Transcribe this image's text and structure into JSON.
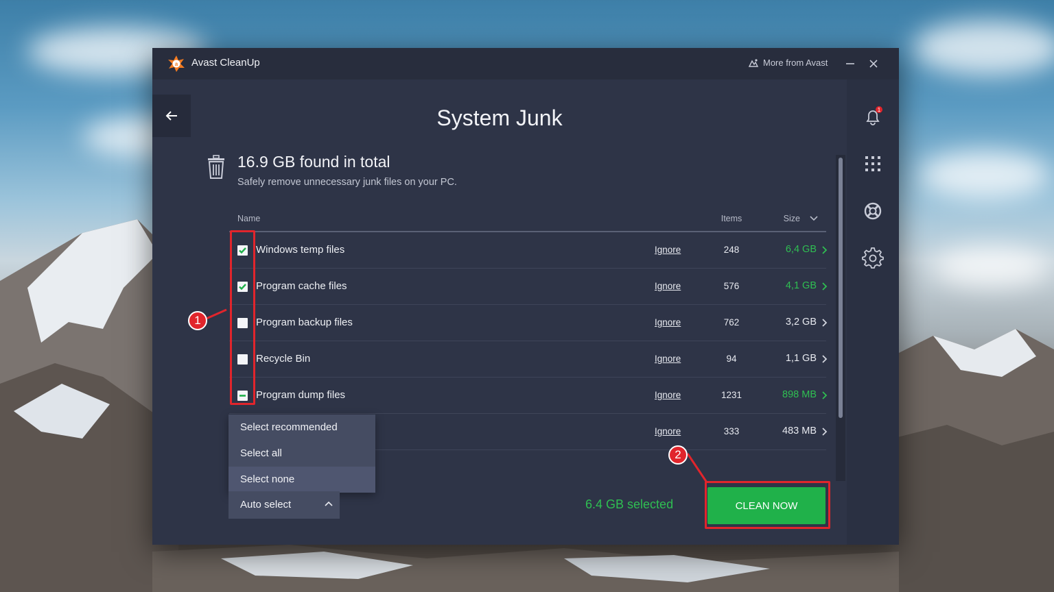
{
  "app": {
    "title": "Avast CleanUp",
    "more_from": "More from Avast"
  },
  "page": {
    "title": "System Junk"
  },
  "summary": {
    "title": "16.9 GB found in total",
    "subtitle": "Safely remove unnecessary junk files on your PC."
  },
  "table": {
    "headers": {
      "name": "Name",
      "items": "Items",
      "size": "Size"
    },
    "rows": [
      {
        "name": "Windows temp files",
        "action": "Ignore",
        "items": "248",
        "size": "6,4 GB",
        "checked": "checked",
        "highlight": true
      },
      {
        "name": "Program cache files",
        "action": "Ignore",
        "items": "576",
        "size": "4,1 GB",
        "checked": "checked",
        "highlight": true
      },
      {
        "name": "Program backup files",
        "action": "Ignore",
        "items": "762",
        "size": "3,2 GB",
        "checked": "unchecked",
        "highlight": false
      },
      {
        "name": "Recycle Bin",
        "action": "Ignore",
        "items": "94",
        "size": "1,1 GB",
        "checked": "unchecked",
        "highlight": false
      },
      {
        "name": "Program dump files",
        "action": "Ignore",
        "items": "1231",
        "size": "898 MB",
        "checked": "partial",
        "highlight": true
      },
      {
        "name": "",
        "action": "Ignore",
        "items": "333",
        "size": "483 MB",
        "checked": "",
        "highlight": false
      }
    ]
  },
  "dropdown": {
    "options": [
      "Select recommended",
      "Select all",
      "Select none"
    ],
    "hovered": "Select none"
  },
  "auto_select": {
    "label": "Auto select"
  },
  "footer": {
    "selected": "6.4 GB selected",
    "clean_button": "CLEAN NOW"
  },
  "notifications": {
    "badge": "1"
  },
  "annotations": {
    "marker1": "1",
    "marker2": "2"
  },
  "colors": {
    "accent_green": "#20b14a",
    "annotation_red": "#e1252c",
    "window_bg": "#2e3447",
    "brand_orange": "#f47b20"
  },
  "icons": [
    "avast-logo-icon",
    "more-from-avast-icon",
    "minimize-icon",
    "close-icon",
    "back-arrow-icon",
    "bell-icon",
    "apps-grid-icon",
    "help-lifebuoy-icon",
    "settings-gear-icon",
    "trash-icon",
    "chevron-right-icon",
    "sort-chevron-icon",
    "caret-up-icon"
  ]
}
